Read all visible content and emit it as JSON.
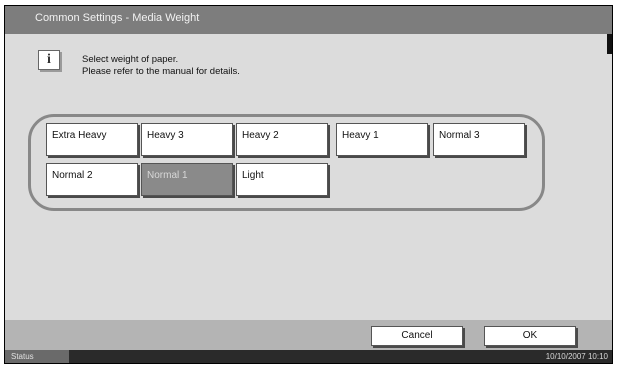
{
  "title": "Common Settings - Media Weight",
  "info": {
    "icon": "info-icon",
    "line1": "Select weight of paper.",
    "line2": "Please refer to the manual for details."
  },
  "weights": [
    {
      "label": "Extra Heavy",
      "selected": false
    },
    {
      "label": "Heavy 3",
      "selected": false
    },
    {
      "label": "Heavy 2",
      "selected": false
    },
    {
      "label": "Heavy 1",
      "selected": false
    },
    {
      "label": "Normal 3",
      "selected": false
    },
    {
      "label": "Normal 2",
      "selected": false
    },
    {
      "label": "Normal 1",
      "selected": true
    },
    {
      "label": "Light",
      "selected": false
    }
  ],
  "footer": {
    "cancel_label": "Cancel",
    "ok_label": "OK"
  },
  "statusbar": {
    "status_label": "Status",
    "datetime": "10/10/2007   10:10"
  }
}
